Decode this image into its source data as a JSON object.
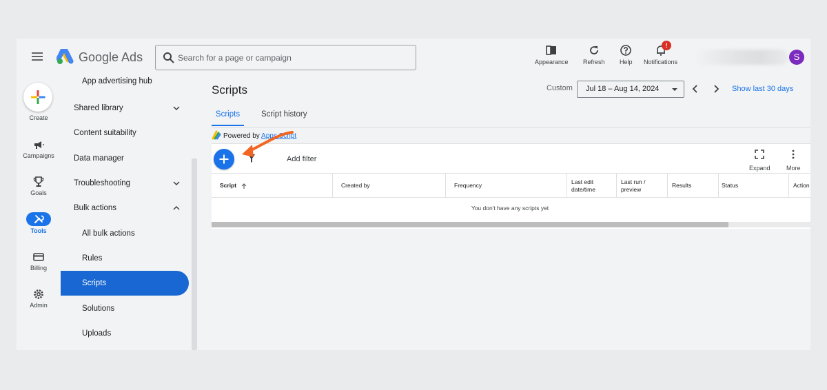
{
  "app": {
    "brand": "Google Ads"
  },
  "search": {
    "placeholder": "Search for a page or campaign"
  },
  "toolbar": {
    "appearance": "Appearance",
    "refresh": "Refresh",
    "help": "Help",
    "notifications": "Notifications",
    "notification_badge": "!",
    "avatar_initial": "S"
  },
  "rail": {
    "create": "Create",
    "campaigns": "Campaigns",
    "goals": "Goals",
    "tools": "Tools",
    "billing": "Billing",
    "admin": "Admin"
  },
  "nav": {
    "items": [
      {
        "label": "App advertising hub"
      },
      {
        "label": "Shared library"
      },
      {
        "label": "Content suitability"
      },
      {
        "label": "Data manager"
      },
      {
        "label": "Troubleshooting"
      },
      {
        "label": "Bulk actions"
      },
      {
        "label": "All bulk actions"
      },
      {
        "label": "Rules"
      },
      {
        "label": "Scripts"
      },
      {
        "label": "Solutions"
      },
      {
        "label": "Uploads"
      }
    ]
  },
  "main": {
    "title": "Scripts",
    "custom_label": "Custom",
    "date_range": "Jul 18 – Aug 14, 2024",
    "show_last": "Show last 30 days",
    "tabs": [
      {
        "label": "Scripts"
      },
      {
        "label": "Script history"
      }
    ],
    "powered_prefix": "Powered by ",
    "powered_link": "Apps Script",
    "add_filter": "Add filter",
    "expand": "Expand",
    "more": "More",
    "columns": [
      {
        "label": "Script"
      },
      {
        "label": "Created by"
      },
      {
        "label": "Frequency"
      },
      {
        "label": "Last edit date/time"
      },
      {
        "label": "Last run / preview"
      },
      {
        "label": "Results"
      },
      {
        "label": "Status"
      },
      {
        "label": "Action"
      }
    ],
    "empty_message": "You don't have any scripts yet"
  },
  "colors": {
    "accent": "#1a73e8",
    "active_nav": "#1967d2",
    "annotation_arrow": "#f26522",
    "avatar": "#7b2cbf",
    "badge": "#d93025"
  }
}
